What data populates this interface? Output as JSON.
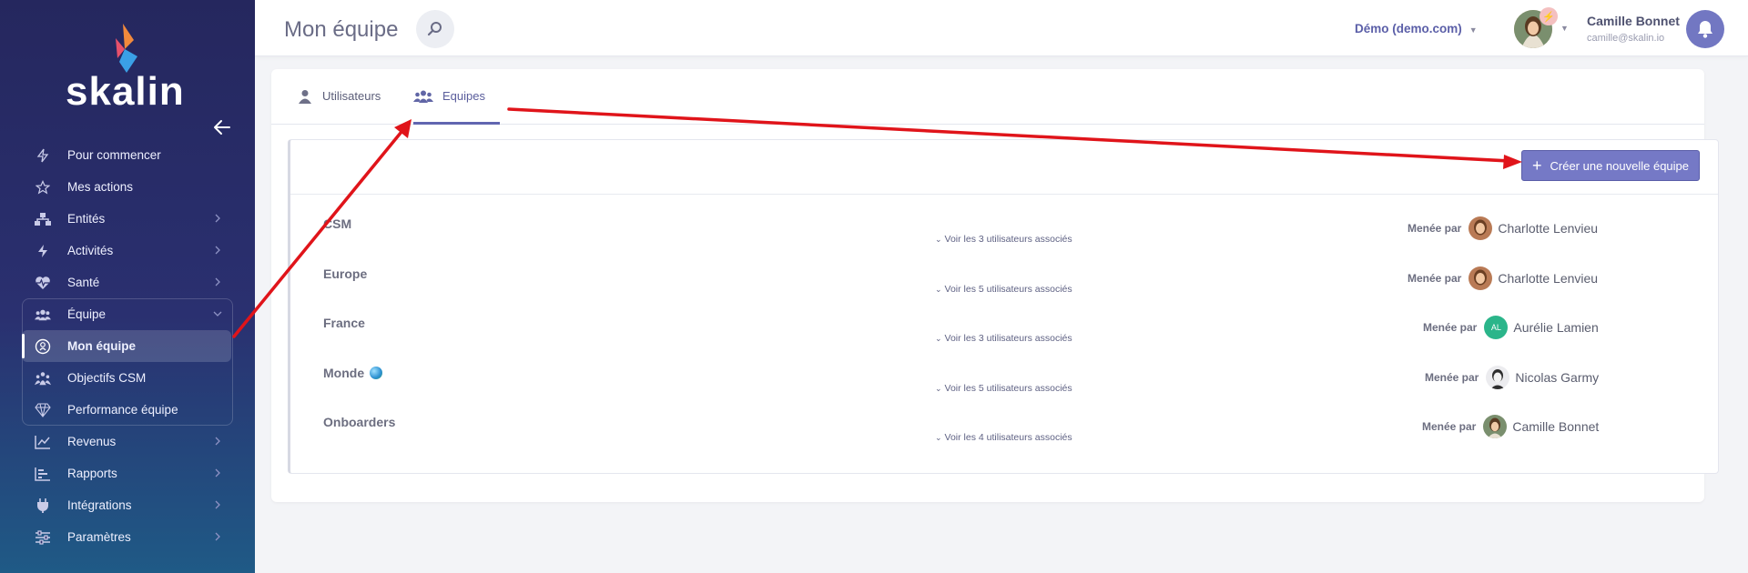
{
  "sidebar": {
    "logo_text": "skalin",
    "items": [
      {
        "label": "Pour commencer",
        "icon": "bolt-outline-icon",
        "has_chevron": false
      },
      {
        "label": "Mes actions",
        "icon": "star-outline-icon",
        "has_chevron": false
      },
      {
        "label": "Entités",
        "icon": "sitemap-icon",
        "has_chevron": true
      },
      {
        "label": "Activités",
        "icon": "bolt-icon",
        "has_chevron": true
      },
      {
        "label": "Santé",
        "icon": "heartbeat-icon",
        "has_chevron": true
      },
      {
        "label": "Équipe",
        "icon": "users-icon",
        "has_chevron": true
      },
      {
        "label": "Mon équipe",
        "icon": "team-circle-icon",
        "has_chevron": false
      },
      {
        "label": "Objectifs CSM",
        "icon": "team-goals-icon",
        "has_chevron": false
      },
      {
        "label": "Performance équipe",
        "icon": "diamond-icon",
        "has_chevron": false
      },
      {
        "label": "Revenus",
        "icon": "line-chart-icon",
        "has_chevron": true
      },
      {
        "label": "Rapports",
        "icon": "bar-chart-icon",
        "has_chevron": true
      },
      {
        "label": "Intégrations",
        "icon": "plug-icon",
        "has_chevron": true
      },
      {
        "label": "Paramètres",
        "icon": "sliders-icon",
        "has_chevron": true
      }
    ]
  },
  "header": {
    "title": "Mon équipe",
    "workspace": "Démo (demo.com)",
    "user_name": "Camille Bonnet",
    "user_email": "camille@skalin.io"
  },
  "tabs": [
    {
      "label": "Utilisateurs",
      "icon": "user-icon",
      "active": false
    },
    {
      "label": "Equipes",
      "icon": "users-icon",
      "active": true
    }
  ],
  "toolbar": {
    "create_label": "Créer une nouvelle équipe"
  },
  "led_by_label": "Menée par",
  "teams": [
    {
      "name": "CSM",
      "link": "Voir les 3 utilisateurs associés",
      "leader": "Charlotte Lenvieu",
      "leader_initials": "",
      "avatar_color": "#c98d6a"
    },
    {
      "name": "Europe",
      "link": "Voir les 5 utilisateurs associés",
      "leader": "Charlotte Lenvieu",
      "leader_initials": "",
      "avatar_color": "#c98d6a"
    },
    {
      "name": "France",
      "link": "Voir les 3 utilisateurs associés",
      "leader": "Aurélie Lamien",
      "leader_initials": "AL",
      "avatar_color": "#2bb58a"
    },
    {
      "name": "Monde",
      "link": "Voir les 5 utilisateurs associés",
      "leader": "Nicolas Garmy",
      "leader_initials": "",
      "avatar_color": "#e9e9ec"
    },
    {
      "name": "Onboarders",
      "link": "Voir les 4 utilisateurs associés",
      "leader": "Camille Bonnet",
      "leader_initials": "",
      "avatar_color": "#c6a27c"
    }
  ],
  "colors": {
    "accent": "#7579c6",
    "sidebar_top": "#25275e",
    "sidebar_bottom": "#1f5a86",
    "annotation_arrow": "#e0141a"
  }
}
